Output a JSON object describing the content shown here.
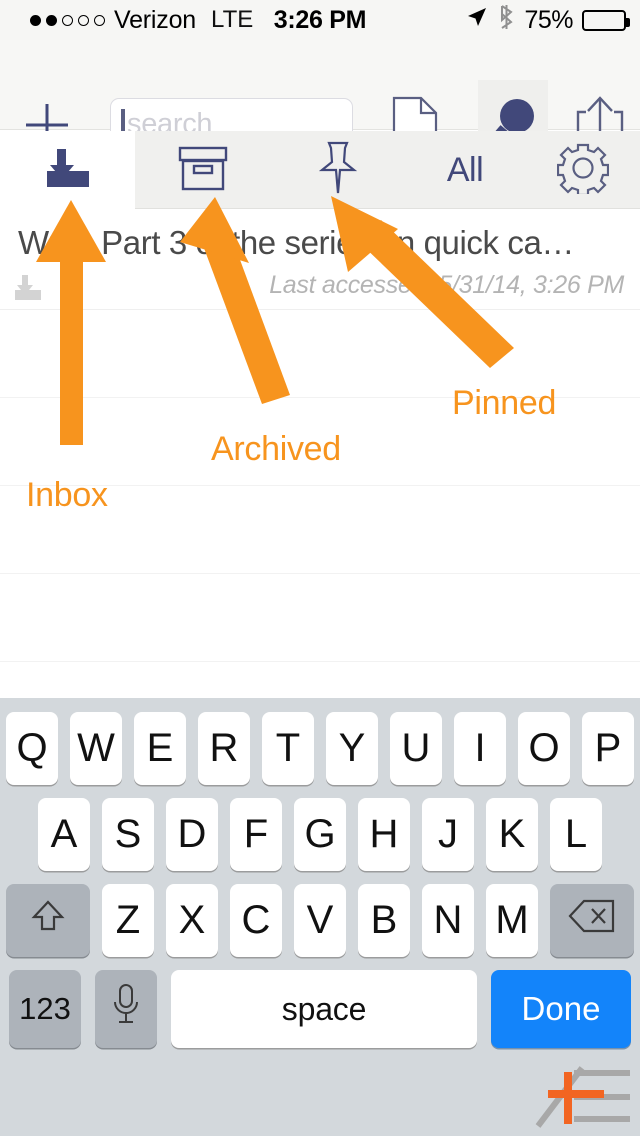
{
  "status_bar": {
    "signal_dots_total": 5,
    "signal_dots_filled": 2,
    "carrier": "Verizon",
    "network": "LTE",
    "time": "3:26 PM",
    "battery_percent": "75%",
    "battery_level": 75,
    "icons": [
      "location-arrow-icon",
      "bluetooth-icon"
    ]
  },
  "toolbar": {
    "add_icon": "plus-icon",
    "search": {
      "value": "",
      "placeholder": "search"
    },
    "document_icon": "document-icon",
    "search_toggle_icon": "magnifier-icon",
    "share_icon": "share-icon",
    "active_item": "magnifier-icon"
  },
  "tabs": [
    {
      "id": "inbox",
      "icon": "inbox-download-icon",
      "label": "",
      "active": true
    },
    {
      "id": "archived",
      "icon": "archive-box-icon",
      "label": "",
      "active": false
    },
    {
      "id": "pinned",
      "icon": "pushpin-icon",
      "label": "",
      "active": false
    },
    {
      "id": "all",
      "icon": "",
      "label": "All",
      "active": false
    },
    {
      "id": "settings",
      "icon": "gear-icon",
      "label": "",
      "active": false
    }
  ],
  "list": {
    "rows": [
      {
        "title": "Write Part 3 of the series on quick ca…",
        "subtitle": "Last accessed: 5/31/14, 3:26 PM",
        "flag_icon": "inbox-download-icon"
      }
    ],
    "empty_row_count": 4
  },
  "keyboard": {
    "row1": [
      "Q",
      "W",
      "E",
      "R",
      "T",
      "Y",
      "U",
      "I",
      "O",
      "P"
    ],
    "row2": [
      "A",
      "S",
      "D",
      "F",
      "G",
      "H",
      "J",
      "K",
      "L"
    ],
    "row3": [
      "Z",
      "X",
      "C",
      "V",
      "B",
      "N",
      "M"
    ],
    "shift_icon": "shift-up-arrow-icon",
    "backspace_icon": "backspace-delete-icon",
    "numbers_key": "123",
    "mic_icon": "microphone-icon",
    "space_key": "space",
    "done_key": "Done"
  },
  "annotations": {
    "color": "#F7941E",
    "labels": [
      {
        "id": "inbox",
        "text": "Inbox"
      },
      {
        "id": "archived",
        "text": "Archived"
      },
      {
        "id": "pinned",
        "text": "Pinned"
      }
    ]
  },
  "colors": {
    "accent_navy": "#41487a",
    "annotation_orange": "#F7941E",
    "done_blue": "#1384fa",
    "keyboard_bg": "#d3d8dc",
    "toolbar_bg": "#f7f7f5",
    "tabbar_bg": "#f0f0ee"
  },
  "watermark": {
    "icon": "logo-watermark-icon"
  }
}
